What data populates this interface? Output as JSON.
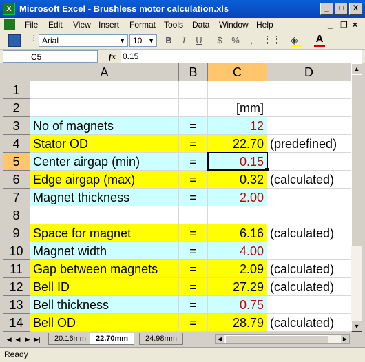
{
  "window": {
    "title": "Microsoft Excel - Brushless motor calculation.xls",
    "app_icon_letter": "X",
    "minimize": "_",
    "maximize": "□",
    "close": "X"
  },
  "menu": {
    "items": [
      "File",
      "Edit",
      "View",
      "Insert",
      "Format",
      "Tools",
      "Data",
      "Window",
      "Help"
    ],
    "doc_minimize": "_",
    "doc_restore": "❐",
    "doc_close": "×"
  },
  "toolbar": {
    "font_name": "Arial",
    "font_size": "10",
    "bold": "B",
    "italic": "I",
    "underline": "U",
    "currency": "$",
    "percent": "%",
    "comma": ","
  },
  "formula_bar": {
    "name_box": "C5",
    "fx": "fx",
    "value": "0.15"
  },
  "columns": [
    "A",
    "B",
    "C",
    "D"
  ],
  "rows": [
    {
      "num": "1",
      "a": "",
      "b": "",
      "c": "",
      "d": "",
      "c_color": "#000000",
      "a_bg": "#ffffff"
    },
    {
      "num": "2",
      "a": "",
      "b": "",
      "c": "[mm]",
      "d": "",
      "c_color": "#000000",
      "a_bg": "#ffffff"
    },
    {
      "num": "3",
      "a": "No of magnets",
      "b": "=",
      "c": "12",
      "d": "",
      "c_color": "#cc0000",
      "a_bg": "#ccffff"
    },
    {
      "num": "4",
      "a": "Stator OD",
      "b": "=",
      "c": "22.70",
      "d": "(predefined)",
      "c_color": "#000000",
      "a_bg": "#ffff00"
    },
    {
      "num": "5",
      "a": "Center airgap (min)",
      "b": "=",
      "c": "0.15",
      "d": "",
      "c_color": "#cc0000",
      "a_bg": "#ccffff"
    },
    {
      "num": "6",
      "a": "Edge airgap (max)",
      "b": "=",
      "c": "0.32",
      "d": "(calculated)",
      "c_color": "#000000",
      "a_bg": "#ffff00"
    },
    {
      "num": "7",
      "a": "Magnet thickness",
      "b": "=",
      "c": "2.00",
      "d": "",
      "c_color": "#cc0000",
      "a_bg": "#ccffff"
    },
    {
      "num": "8",
      "a": "",
      "b": "",
      "c": "",
      "d": "",
      "c_color": "#000000",
      "a_bg": "#ffffff"
    },
    {
      "num": "9",
      "a": "Space for magnet",
      "b": "=",
      "c": "6.16",
      "d": "(calculated)",
      "c_color": "#000000",
      "a_bg": "#ffff00"
    },
    {
      "num": "10",
      "a": "Magnet width",
      "b": "=",
      "c": "4.00",
      "d": "",
      "c_color": "#cc0000",
      "a_bg": "#ccffff"
    },
    {
      "num": "11",
      "a": "Gap between magnets",
      "b": "=",
      "c": "2.09",
      "d": "(calculated)",
      "c_color": "#000000",
      "a_bg": "#ffff00"
    },
    {
      "num": "12",
      "a": "Bell ID",
      "b": "=",
      "c": "27.29",
      "d": "(calculated)",
      "c_color": "#000000",
      "a_bg": "#ffff00"
    },
    {
      "num": "13",
      "a": "Bell thickness",
      "b": "=",
      "c": "0.75",
      "d": "",
      "c_color": "#cc0000",
      "a_bg": "#ccffff"
    },
    {
      "num": "14",
      "a": "Bell OD",
      "b": "=",
      "c": "28.79",
      "d": "(calculated)",
      "c_color": "#000000",
      "a_bg": "#ffff00"
    }
  ],
  "selected_cell": {
    "row": "5",
    "col": "C"
  },
  "sheet_tabs": [
    "20.16mm",
    "22.70mm",
    "24.98mm"
  ],
  "active_tab": "22.70mm",
  "status": "Ready"
}
